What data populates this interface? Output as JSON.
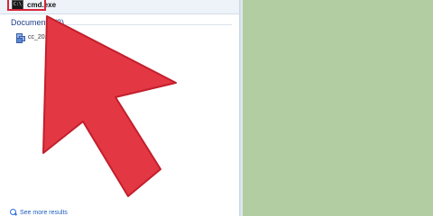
{
  "start_menu": {
    "program_result": {
      "label": "cmd.exe",
      "icon": "cmd-icon",
      "icon_glyph": "C:\\"
    },
    "documents_section": {
      "heading": "Documents (2)",
      "item_label": "cc_20...6.reg",
      "item_icon": "registry-file-icon"
    },
    "see_more": {
      "label": "See more results",
      "icon": "search-icon"
    }
  },
  "annotation": {
    "arrow_icon": "red-pointer-arrow",
    "arrow_color": "#e43744",
    "highlight_color": "#d8263a"
  },
  "colors": {
    "desktop_background": "#b3cda2",
    "panel_background": "#ffffff",
    "heading_color": "#1e3c8c",
    "link_color": "#1e5fc0"
  }
}
